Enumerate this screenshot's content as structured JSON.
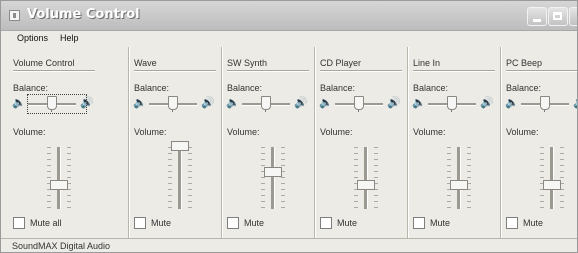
{
  "window": {
    "title": "Volume Control"
  },
  "menu": {
    "options": "Options",
    "help": "Help"
  },
  "panels": [
    {
      "name": "Volume Control",
      "balance_label": "Balance:",
      "volume_label": "Volume:",
      "mute_label": "Mute all",
      "balance": 0.5,
      "volume": 0.25,
      "muted": false
    },
    {
      "name": "Wave",
      "balance_label": "Balance:",
      "volume_label": "Volume:",
      "mute_label": "Mute",
      "balance": 0.5,
      "volume": 1.0,
      "muted": false
    },
    {
      "name": "SW Synth",
      "balance_label": "Balance:",
      "volume_label": "Volume:",
      "mute_label": "Mute",
      "balance": 0.5,
      "volume": 0.5,
      "muted": false
    },
    {
      "name": "CD Player",
      "balance_label": "Balance:",
      "volume_label": "Volume:",
      "mute_label": "Mute",
      "balance": 0.5,
      "volume": 0.25,
      "muted": false
    },
    {
      "name": "Line In",
      "balance_label": "Balance:",
      "volume_label": "Volume:",
      "mute_label": "Mute",
      "balance": 0.5,
      "volume": 0.25,
      "muted": false
    },
    {
      "name": "PC Beep",
      "balance_label": "Balance:",
      "volume_label": "Volume:",
      "mute_label": "Mute",
      "balance": 0.5,
      "volume": 0.25,
      "muted": false
    }
  ],
  "status": "SoundMAX Digital Audio",
  "colors": {
    "titlebar": "#c8c8c8",
    "face": "#ecebe5",
    "text": "#333333"
  }
}
